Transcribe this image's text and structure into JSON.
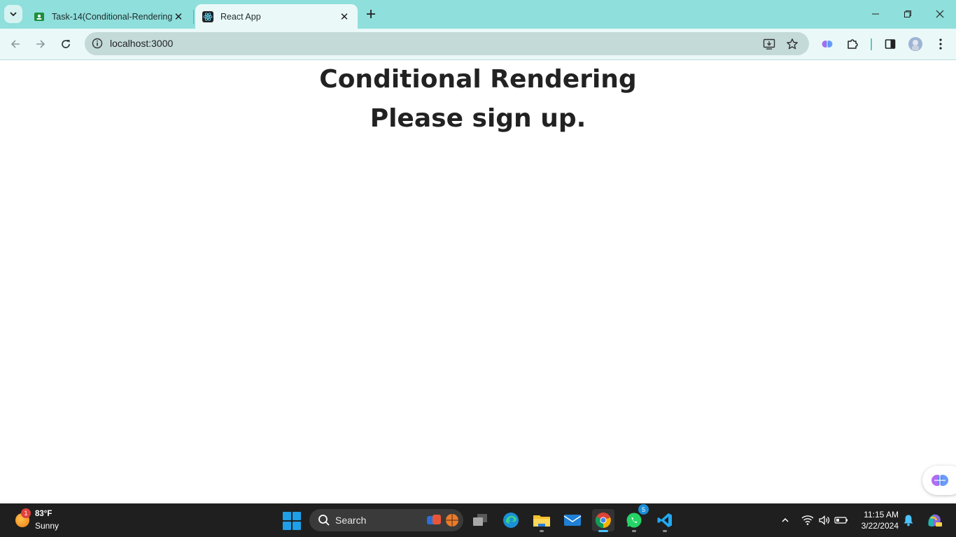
{
  "browser": {
    "tabs": [
      {
        "title": "Task-14(Conditional-Rendering)",
        "active": false
      },
      {
        "title": "React App",
        "active": true
      }
    ],
    "url": "localhost:3000"
  },
  "page": {
    "heading": "Conditional Rendering",
    "message": "Please sign up."
  },
  "taskbar": {
    "weather": {
      "temp": "83°F",
      "condition": "Sunny",
      "badge": "1"
    },
    "search_label": "Search",
    "whatsapp_badge": "5",
    "time": "11:15 AM",
    "date": "3/22/2024"
  },
  "colors": {
    "tabstrip": "#8fdfdc",
    "toolbar": "#eaf9f8",
    "omnibox": "#c3dad9",
    "taskbar": "#1f1f1f",
    "accent": "#4cc2ff"
  }
}
